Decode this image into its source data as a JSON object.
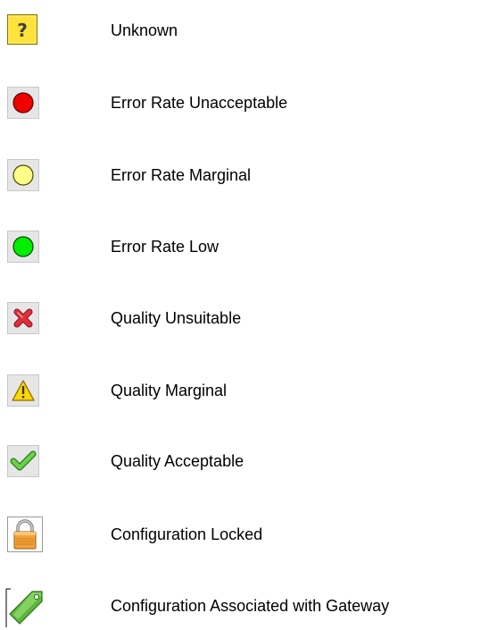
{
  "legend": {
    "items": [
      {
        "icon": "question-mark-icon",
        "label": "Unknown"
      },
      {
        "icon": "red-circle-icon",
        "label": "Error Rate Unacceptable",
        "color": "#ee0000"
      },
      {
        "icon": "yellow-circle-icon",
        "label": "Error Rate Marginal",
        "color": "#ffff88"
      },
      {
        "icon": "green-circle-icon",
        "label": "Error Rate Low",
        "color": "#00ee00"
      },
      {
        "icon": "red-x-icon",
        "label": "Quality Unsuitable",
        "color": "#e0303a"
      },
      {
        "icon": "warning-triangle-icon",
        "label": "Quality Marginal",
        "color": "#ffd800"
      },
      {
        "icon": "green-check-icon",
        "label": "Quality Acceptable",
        "color": "#44bb33"
      },
      {
        "icon": "padlock-icon",
        "label": "Configuration Locked",
        "color": "#f3a33a"
      },
      {
        "icon": "green-tag-icon",
        "label": "Configuration Associated with Gateway",
        "color": "#5cb83a"
      }
    ]
  }
}
